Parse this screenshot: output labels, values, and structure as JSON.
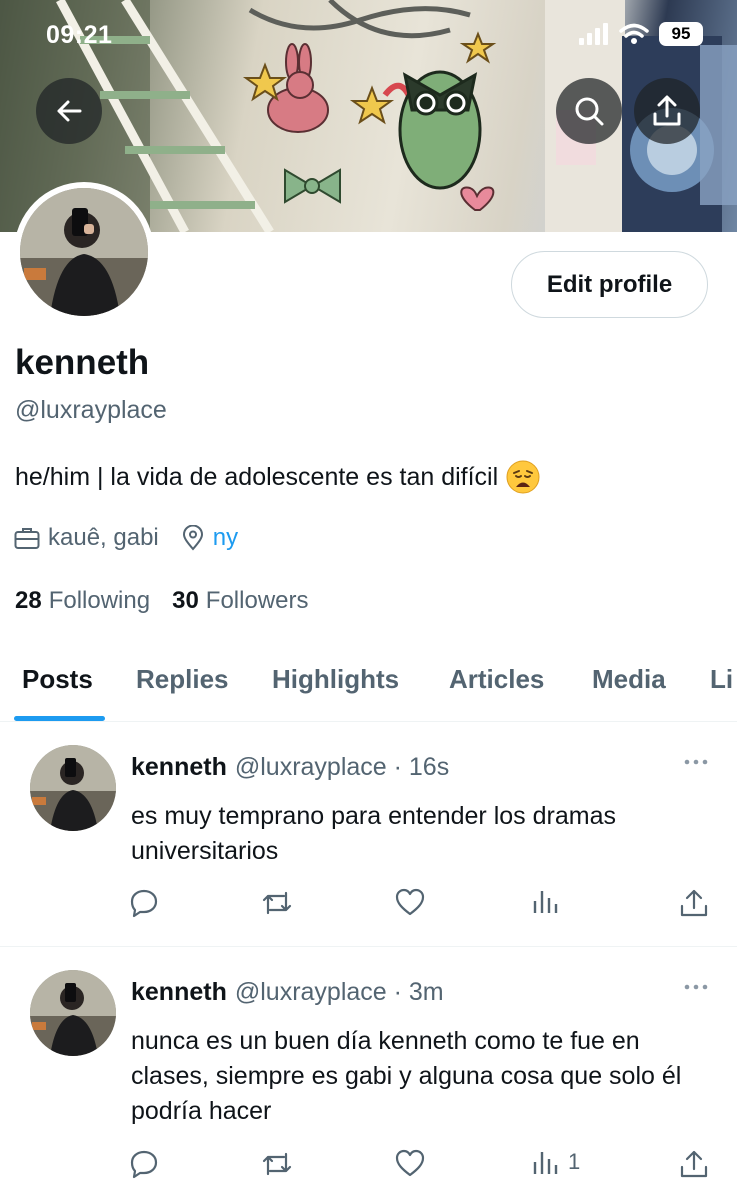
{
  "status_bar": {
    "time": "09:21",
    "battery": "95"
  },
  "header": {
    "back_icon": "arrow-left-icon",
    "search_icon": "search-icon",
    "share_icon": "share-icon"
  },
  "profile": {
    "name": "kenneth",
    "handle": "@luxrayplace",
    "bio": "he/him | la vida de adolescente es tan difícil",
    "bio_emoji": "weary-face",
    "work": "kauê, gabi",
    "location": "ny",
    "following_count": "28",
    "following_label": "Following",
    "followers_count": "30",
    "followers_label": "Followers",
    "edit_label": "Edit profile"
  },
  "tabs": [
    "Posts",
    "Replies",
    "Highlights",
    "Articles",
    "Media",
    "Li"
  ],
  "active_tab": "Posts",
  "colors": {
    "accent": "#1d9bf0",
    "muted": "#536471",
    "text": "#0f1419"
  },
  "posts": [
    {
      "name": "kenneth",
      "meta": "@luxrayplace · 16s",
      "text": "es muy temprano para entender los dramas universitarios",
      "views": ""
    },
    {
      "name": "kenneth",
      "meta": "@luxrayplace · 3m",
      "text": "nunca es un buen día kenneth como te fue en clases, siempre es gabi y alguna cosa que solo él podría hacer",
      "views": "1"
    }
  ]
}
